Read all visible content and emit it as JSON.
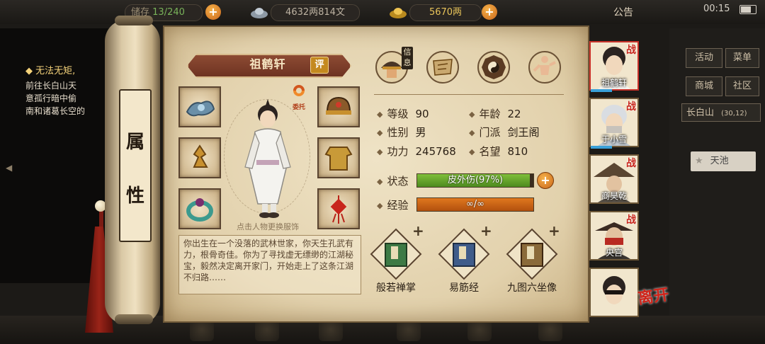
{
  "top_bar": {
    "resource_1": "13/240",
    "resource_1_prefix": "储存",
    "silver": "4632两814文",
    "gold": "5670两",
    "notice": "公告",
    "clock": "00:15"
  },
  "quest": {
    "title": "无法无矩,",
    "lines": [
      "前往长白山天",
      "意孤行暗中偷",
      "南和诸葛长空的"
    ]
  },
  "right_menu": {
    "activity": "活动",
    "menu": "菜单",
    "shop": "商城",
    "community": "社区",
    "location": "长白山",
    "coords": "(30,12)",
    "tianchi": "天池"
  },
  "scroll": {
    "label_chars": [
      "属",
      "性"
    ]
  },
  "character": {
    "name": "祖鹤轩",
    "review_badge": "评",
    "entrust_label": "委托",
    "change_outfit_tip": "点击人物更换服饰",
    "bio": "你出生在一个没落的武林世家，你天生孔武有力，根骨奇佳。你为了寻找虚无缥缈的江湖秘宝，毅然决定离开家门，开始走上了这条江湖不归路……"
  },
  "tabs": {
    "info_label": "信息"
  },
  "stats": {
    "level_label": "等级",
    "level": "90",
    "age_label": "年龄",
    "age": "22",
    "gender_label": "性别",
    "gender": "男",
    "sect_label": "门派",
    "sect": "剑王阁",
    "power_label": "功力",
    "power": "245768",
    "fame_label": "名望",
    "fame": "810",
    "status_label": "状态",
    "status_text": "皮外伤(97%)",
    "status_pct": 97,
    "exp_label": "经验",
    "exp_text": "∞/∞"
  },
  "skills": [
    {
      "name": "般若禅掌"
    },
    {
      "name": "易筋经"
    },
    {
      "name": "九图六坐像"
    }
  ],
  "roster": [
    {
      "name": "祖鹤轩",
      "tag": "战",
      "active": true
    },
    {
      "name": "于小雪",
      "tag": "战",
      "active": false
    },
    {
      "name": "商昊乾",
      "tag": "战",
      "active": false
    },
    {
      "name": "央宫",
      "tag": "战",
      "active": false
    },
    {
      "name": "",
      "tag": "",
      "active": false
    }
  ],
  "leave_label": "离开",
  "colors": {
    "status_bar": "#7fbf3a",
    "exp_bar": "#e0781e",
    "accent_red": "#c8251c",
    "paper": "#e9dab8"
  }
}
